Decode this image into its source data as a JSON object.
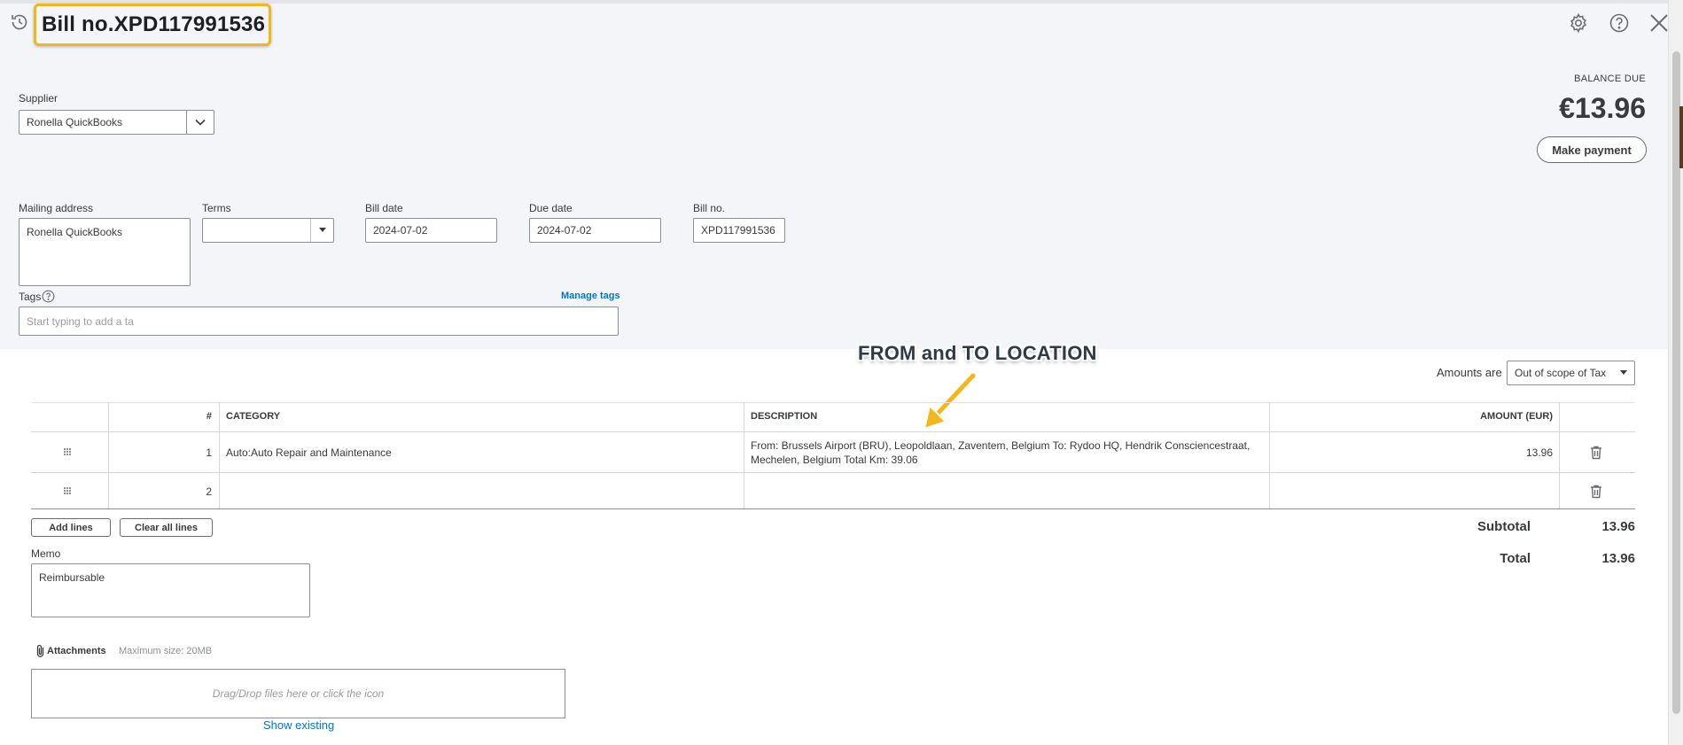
{
  "header": {
    "title": "Bill no.XPD117991536",
    "history_icon": "history-icon",
    "settings_icon": "gear-icon",
    "help_icon": "help-icon",
    "close_icon": "close-icon"
  },
  "supplier": {
    "label": "Supplier",
    "value": "Ronella QuickBooks"
  },
  "balance": {
    "label": "BALANCE DUE",
    "amount": "€13.96",
    "make_payment": "Make payment"
  },
  "mailing_address": {
    "label": "Mailing address",
    "value": "Ronella QuickBooks"
  },
  "terms": {
    "label": "Terms",
    "value": ""
  },
  "bill_date": {
    "label": "Bill date",
    "value": "2024-07-02"
  },
  "due_date": {
    "label": "Due date",
    "value": "2024-07-02"
  },
  "bill_no": {
    "label": "Bill no.",
    "value": "XPD117991536"
  },
  "tags": {
    "label": "Tags",
    "manage": "Manage tags",
    "placeholder": "Start typing to add a ta"
  },
  "amounts_are": {
    "label": "Amounts are",
    "value": "Out of scope of Tax"
  },
  "annotation": "FROM and TO LOCATION",
  "table": {
    "headers": {
      "number": "#",
      "category": "CATEGORY",
      "description": "DESCRIPTION",
      "amount": "AMOUNT (EUR)"
    },
    "rows": [
      {
        "number": "1",
        "category": "Auto:Auto Repair and Maintenance",
        "description": "From: Brussels Airport (BRU), Leopoldlaan, Zaventem, Belgium To: Rydoo HQ, Hendrik Consciencestraat, Mechelen, Belgium Total  Km: 39.06",
        "amount": "13.96"
      },
      {
        "number": "2",
        "category": "",
        "description": "",
        "amount": ""
      }
    ]
  },
  "buttons": {
    "add_lines": "Add lines",
    "clear_all_lines": "Clear all lines"
  },
  "totals": {
    "subtotal_label": "Subtotal",
    "subtotal_value": "13.96",
    "total_label": "Total",
    "total_value": "13.96"
  },
  "memo": {
    "label": "Memo",
    "value": "Reimbursable"
  },
  "attachments": {
    "label": "Attachments",
    "max_size": "Maximum size: 20MB",
    "dropzone": "Drag/Drop files here or click the icon",
    "show_existing": "Show existing"
  },
  "colors": {
    "highlight_border": "#f2b81b",
    "link": "#0077c5",
    "annotation_arrow": "#f2b81b"
  }
}
